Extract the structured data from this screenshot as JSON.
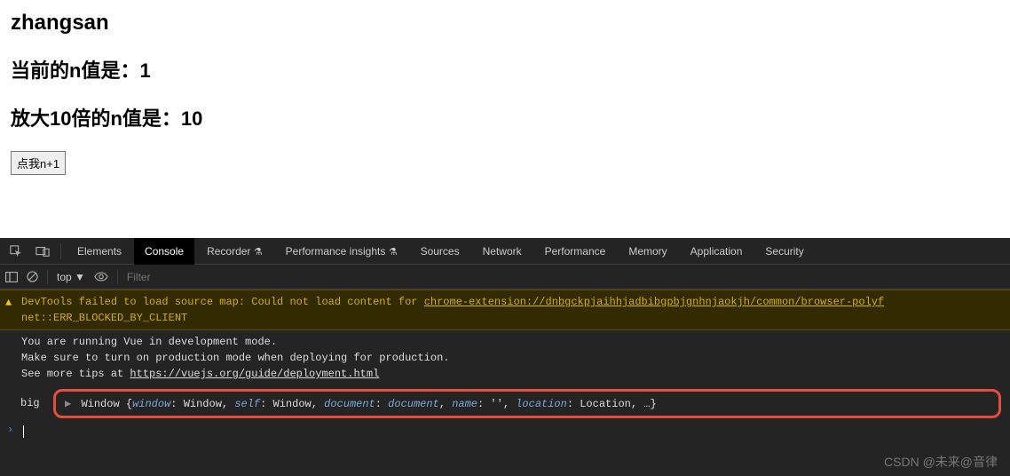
{
  "page": {
    "name": "zhangsan",
    "line1_label": "当前的n值是：",
    "line1_value": "1",
    "line2_label": "放大10倍的n值是：",
    "line2_value": "10",
    "button_label": "点我n+1"
  },
  "devtools": {
    "tabs": {
      "elements": "Elements",
      "console": "Console",
      "recorder": "Recorder",
      "perf_insights": "Performance insights",
      "sources": "Sources",
      "network": "Network",
      "performance": "Performance",
      "memory": "Memory",
      "application": "Application",
      "security": "Security"
    },
    "filter": {
      "context": "top",
      "placeholder": "Filter"
    },
    "console": {
      "warn_prefix": "DevTools failed to load source map: Could not load content for ",
      "warn_link": "chrome-extension://dnbgckpjaihhjadbibgpbjgnhnjaokjh/common/browser-polyf",
      "warn_line2": "net::ERR_BLOCKED_BY_CLIENT",
      "vue_line1": "You are running Vue in development mode.",
      "vue_line2": "Make sure to turn on production mode when deploying for production.",
      "vue_line3_prefix": "See more tips at ",
      "vue_line3_link": "https://vuejs.org/guide/deployment.html",
      "highlight_label": "big",
      "obj": {
        "class": "Window",
        "k1": "window",
        "v1": "Window",
        "k2": "self",
        "v2": "Window",
        "k3": "document",
        "v3": "document",
        "k4": "name",
        "v4": "''",
        "k5": "location",
        "v5": "Location",
        "ellipsis": "…"
      }
    }
  },
  "watermark": "CSDN @未来@音律"
}
